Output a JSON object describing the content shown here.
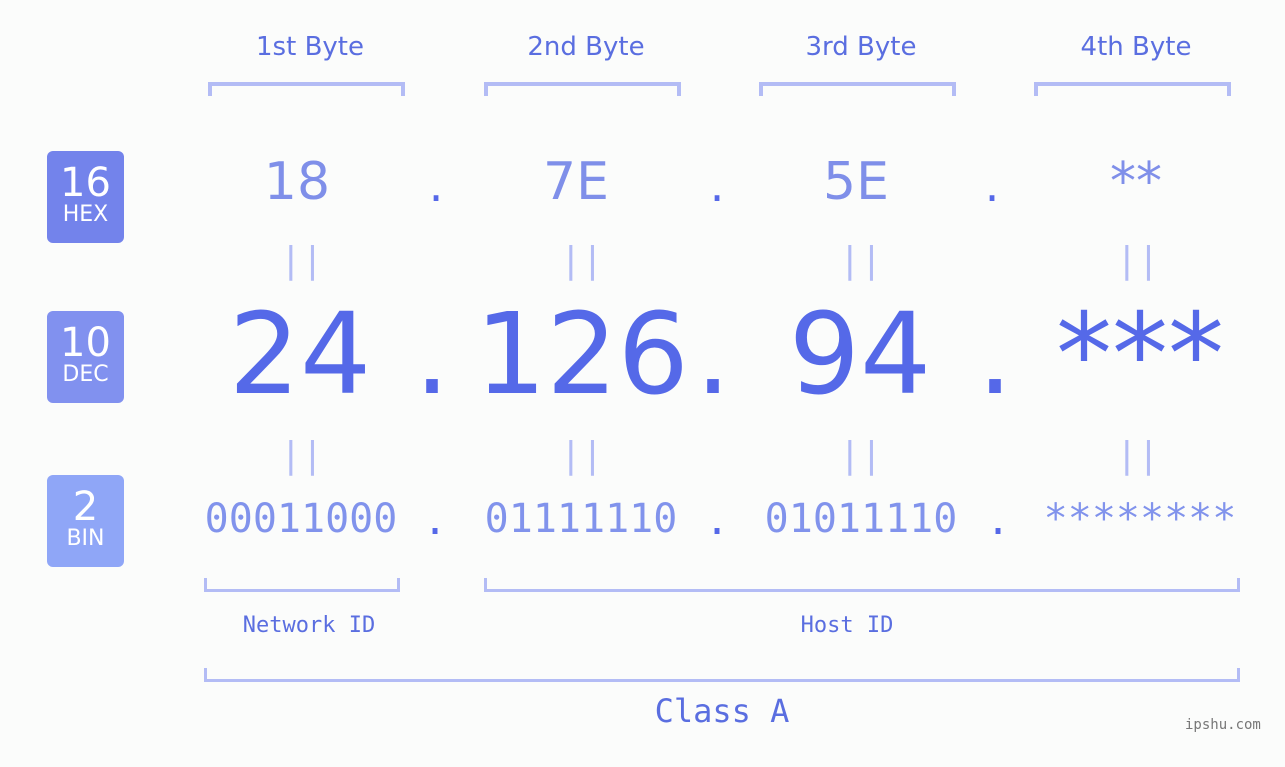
{
  "bytes": [
    {
      "label": "1st Byte",
      "hex": "18",
      "dec": "24",
      "bin": "00011000"
    },
    {
      "label": "2nd Byte",
      "hex": "7E",
      "dec": "126",
      "bin": "01111110"
    },
    {
      "label": "3rd Byte",
      "hex": "5E",
      "dec": "94",
      "bin": "01011110"
    },
    {
      "label": "4th Byte",
      "hex": "**",
      "dec": "***",
      "bin": "********"
    }
  ],
  "separator": ".",
  "equals": "||",
  "badges": {
    "hex": {
      "num": "16",
      "label": "HEX",
      "color": "#7383eb"
    },
    "dec": {
      "num": "10",
      "label": "DEC",
      "color": "#8191ef"
    },
    "bin": {
      "num": "2",
      "label": "BIN",
      "color": "#8fa6f7"
    }
  },
  "network_id_label": "Network ID",
  "host_id_label": "Host ID",
  "class_label": "Class A",
  "watermark": "ipshu.com"
}
